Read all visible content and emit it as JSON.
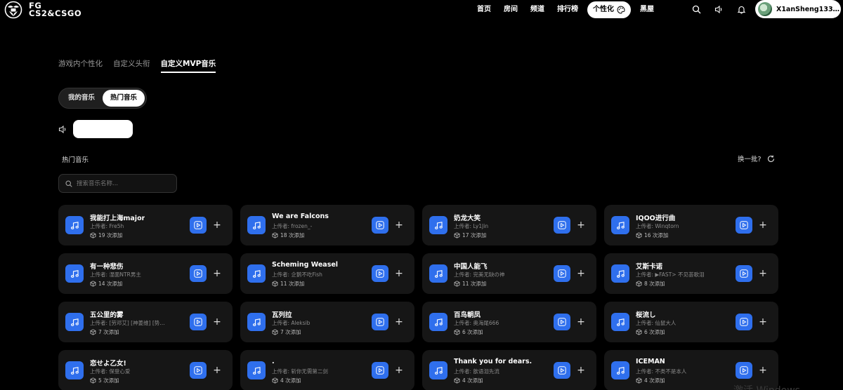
{
  "logo": {
    "line1": "FG",
    "line2": "CS2&CSGO"
  },
  "nav": {
    "items": [
      "首页",
      "房间",
      "频道",
      "排行榜"
    ],
    "active": "个性化",
    "after": "黑屋"
  },
  "user": {
    "name": "X1anSheng133…"
  },
  "subtabs": [
    "游戏内个性化",
    "自定义头衔",
    "自定义MVP音乐"
  ],
  "segment": {
    "mine": "我的音乐",
    "hot": "热门音乐"
  },
  "section_title": "热门音乐",
  "refresh_label": "换一批?",
  "search": {
    "placeholder": "搜索音乐名称..."
  },
  "cards": [
    {
      "title": "我能打上海major",
      "uploader": "上传者: Fre5h",
      "adds": "19 次添加"
    },
    {
      "title": "We are Falcons",
      "uploader": "上传者: frozen_-",
      "adds": "18 次添加"
    },
    {
      "title": "奶龙大笑",
      "uploader": "上传者: Ly1Jin",
      "adds": "17 次添加"
    },
    {
      "title": "IQOO进行曲",
      "uploader": "上传者: Winqtorn",
      "adds": "16 次添加"
    },
    {
      "title": "有一种悲伤",
      "uploader": "上传者: 湿面NTR男主",
      "adds": "14 次添加"
    },
    {
      "title": "Scheming Weasel",
      "uploader": "上传者: 企鹅不吃Fish",
      "adds": "11 次添加"
    },
    {
      "title": "中国人能飞",
      "uploader": "上传者: 完美无缺の神",
      "adds": "11 次添加"
    },
    {
      "title": "艾斯卡诺",
      "uploader": "上传者: ▶FAST> 不见荟歌泪",
      "adds": "8 次添加"
    },
    {
      "title": "五公里的雾",
      "uploader": "上传者: [劳邓艾] [神姜维] [势…",
      "adds": "7 次添加"
    },
    {
      "title": "瓦列拉",
      "uploader": "上传者: Aleksib",
      "adds": "7 次添加"
    },
    {
      "title": "百鸟朝凤",
      "uploader": "上传者: 奥海尾666",
      "adds": "6 次添加"
    },
    {
      "title": "桜流し",
      "uploader": "上传者: 仙鼠大人",
      "adds": "6 次添加"
    },
    {
      "title": "恋せよ乙女!",
      "uploader": "上传者: 保登心爱",
      "adds": "5 次添加"
    },
    {
      "title": ".",
      "uploader": "上传者: 斩你无需第二剑",
      "adds": "4 次添加"
    },
    {
      "title": "Thank you for dears.",
      "uploader": "上传者: 歆语泪先流",
      "adds": "4 次添加"
    },
    {
      "title": "ICEMAN",
      "uploader": "上传者: 不类不是本人",
      "adds": "4 次添加"
    }
  ],
  "watermark": "激活 Windows",
  "icons": {
    "search": "search-icon",
    "volume": "volume-icon",
    "bell": "bell-icon",
    "palette": "palette-icon",
    "refresh": "refresh-icon",
    "note": "music-note-icon",
    "play": "play-icon",
    "plus": "plus-icon",
    "cube": "cube-icon"
  },
  "colors": {
    "accent": "#2f6fed",
    "card_bg": "#161616",
    "page_bg": "#000000"
  }
}
